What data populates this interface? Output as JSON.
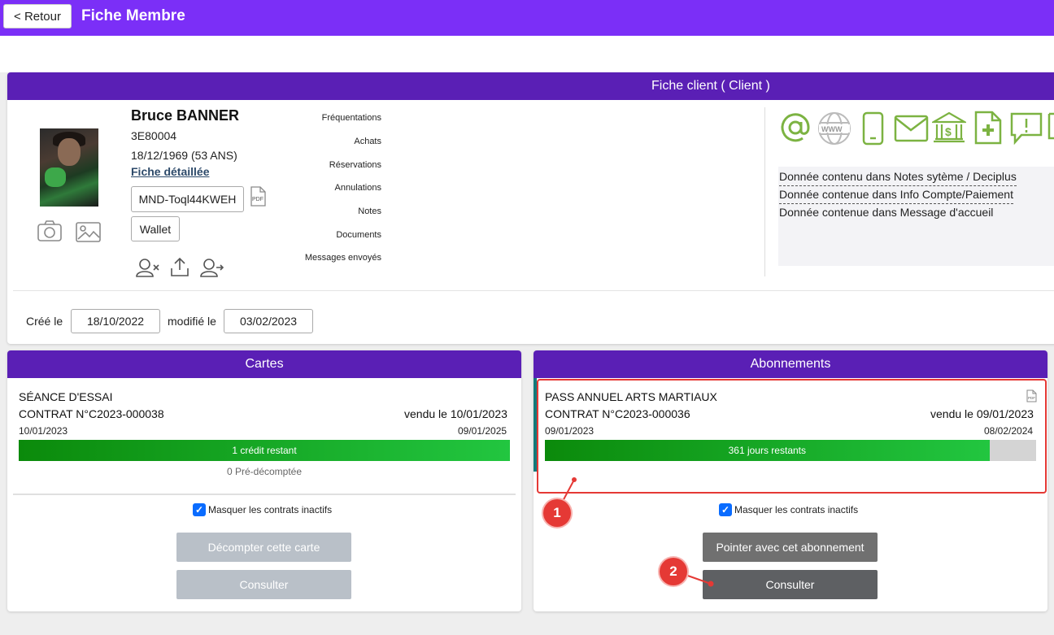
{
  "header": {
    "back_label": "< Retour",
    "title": "Fiche Membre"
  },
  "client_panel": {
    "title": "Fiche client ( Client )",
    "member": {
      "name": "Bruce BANNER",
      "code": "3E80004",
      "birth": "18/12/1969 (53 ANS)",
      "details_link": "Fiche détaillée",
      "mandate": "MND-Toql44KWEH",
      "wallet": "Wallet"
    },
    "menu": [
      "Fréquentations",
      "Achats",
      "Réservations",
      "Annulations",
      "Notes",
      "Documents",
      "Messages envoyés"
    ],
    "notes": [
      "Donnée contenu dans Notes sytème / Deciplus",
      "Donnée contenue dans Info Compte/Paiement",
      "Donnée contenue dans Message d'accueil"
    ],
    "created_label": "Créé le",
    "created_value": "18/10/2022",
    "modified_label": "modifié le",
    "modified_value": "03/02/2023",
    "contact_icons": [
      "at-icon",
      "web-icon",
      "phone-icon",
      "mail-icon",
      "bank-icon",
      "medical-doc-icon",
      "message-alert-icon"
    ],
    "pdf_icon_label": "PDF"
  },
  "cartes": {
    "title": "Cartes",
    "item": {
      "name": "SÉANCE D'ESSAI",
      "contract": "CONTRAT N°C2023-000038",
      "sold": "vendu le 10/01/2023",
      "start": "10/01/2023",
      "end": "09/01/2025",
      "bar_label": "1 crédit restant",
      "progress": 1.0,
      "pre": "0 Pré-décomptée"
    },
    "checkbox_label": "Masquer les contrats inactifs",
    "btn_decompter": "Décompter cette carte",
    "btn_consulter": "Consulter"
  },
  "abonnements": {
    "title": "Abonnements",
    "item": {
      "name": "PASS ANNUEL ARTS MARTIAUX",
      "contract": "CONTRAT N°C2023-000036",
      "sold": "vendu le 09/01/2023",
      "start": "09/01/2023",
      "end": "08/02/2024",
      "bar_label": "361 jours restants",
      "progress": 0.905,
      "pdf_label": "PDF"
    },
    "checkbox_label": "Masquer les contrats inactifs",
    "btn_pointer": "Pointer avec cet abonnement",
    "btn_consulter": "Consulter"
  },
  "annotations": {
    "badge1": "1",
    "badge2": "2",
    "color": "#e53935"
  }
}
